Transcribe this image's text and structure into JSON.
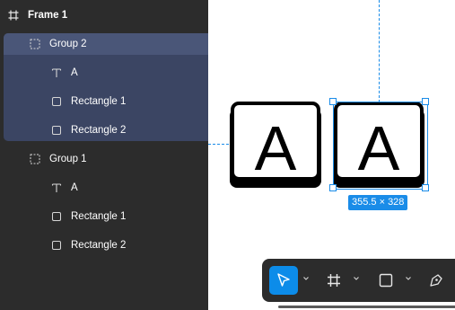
{
  "layers": {
    "frame": {
      "label": "Frame 1",
      "icon": "frame-icon"
    },
    "items": [
      {
        "label": "Group 2",
        "icon": "group-icon"
      },
      {
        "label": "A",
        "icon": "text-icon"
      },
      {
        "label": "Rectangle 1",
        "icon": "rectangle-icon"
      },
      {
        "label": "Rectangle 2",
        "icon": "rectangle-icon"
      },
      {
        "label": "Group 1",
        "icon": "group-icon"
      },
      {
        "label": "A",
        "icon": "text-icon"
      },
      {
        "label": "Rectangle 1",
        "icon": "rectangle-icon"
      },
      {
        "label": "Rectangle 2",
        "icon": "rectangle-icon"
      }
    ]
  },
  "canvas": {
    "key_left_letter": "A",
    "key_right_letter": "A",
    "selection_size": "355.5 × 328"
  },
  "toolbar": {
    "tools": [
      "move-tool",
      "frame-tool",
      "shape-tool",
      "pen-tool"
    ],
    "active_tool": "move-tool"
  },
  "colors": {
    "panel_bg": "#2c2c2c",
    "selection_bg": "#3b4563",
    "selection_head": "#4a5678",
    "accent": "#1a8ce8",
    "canvas_bg": "#ffffff"
  }
}
